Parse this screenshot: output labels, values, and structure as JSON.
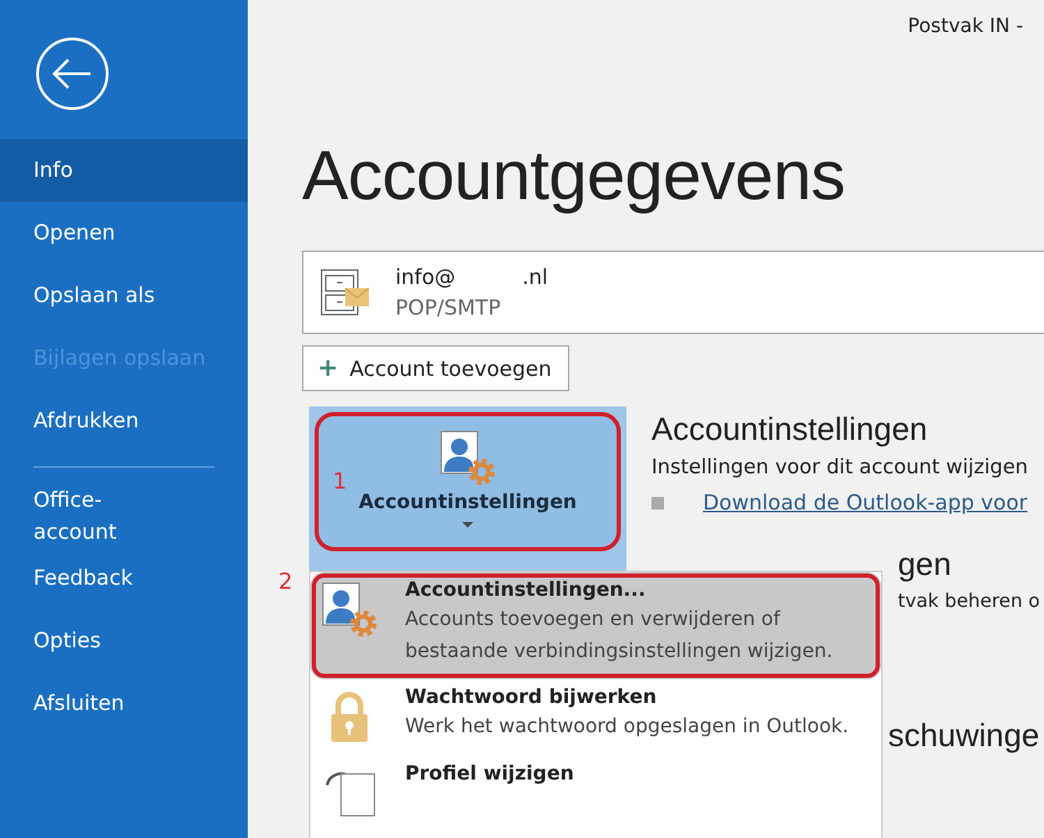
{
  "window": {
    "title": "Postvak IN -"
  },
  "sidebar": {
    "items": [
      {
        "label": "Info",
        "selected": true,
        "disabled": false
      },
      {
        "label": "Openen",
        "selected": false,
        "disabled": false
      },
      {
        "label": "Opslaan als",
        "selected": false,
        "disabled": false
      },
      {
        "label": "Bijlagen opslaan",
        "selected": false,
        "disabled": true
      },
      {
        "label": "Afdrukken",
        "selected": false,
        "disabled": false,
        "divider_after": true
      },
      {
        "label": "Office-\naccount",
        "selected": false,
        "disabled": false
      },
      {
        "label": "Feedback",
        "selected": false,
        "disabled": false
      },
      {
        "label": "Opties",
        "selected": false,
        "disabled": false
      },
      {
        "label": "Afsluiten",
        "selected": false,
        "disabled": false
      }
    ]
  },
  "heading": "Accountgegevens",
  "account": {
    "address_start": "info@",
    "address_end": ".nl",
    "type": "POP/SMTP"
  },
  "add_button": {
    "icon": "+",
    "label": "Account toevoegen"
  },
  "settings_tile": {
    "label": "Accountinstellingen",
    "marker": "1"
  },
  "settings_section": {
    "title": "Accountinstellingen",
    "description": "Instellingen voor dit account wijzigen",
    "link": "Download de Outlook-app voor"
  },
  "partial_texts": [
    {
      "kind": "heading",
      "text": "gen"
    },
    {
      "kind": "line",
      "text": "tvak beheren o"
    },
    {
      "kind": "heading",
      "text": "schuwinge"
    }
  ],
  "dropdown": {
    "marker": "2",
    "items": [
      {
        "kind": "settings",
        "title": "Accountinstellingen...",
        "description": "Accounts toevoegen en verwijderen of bestaande verbindingsinstellingen wijzigen.",
        "selected": true
      },
      {
        "kind": "lock",
        "title": "Wachtwoord bijwerken",
        "description": "Werk het wachtwoord opgeslagen in Outlook.",
        "selected": false
      },
      {
        "kind": "profile",
        "title": "Profiel wijzigen",
        "selected": false
      }
    ]
  }
}
